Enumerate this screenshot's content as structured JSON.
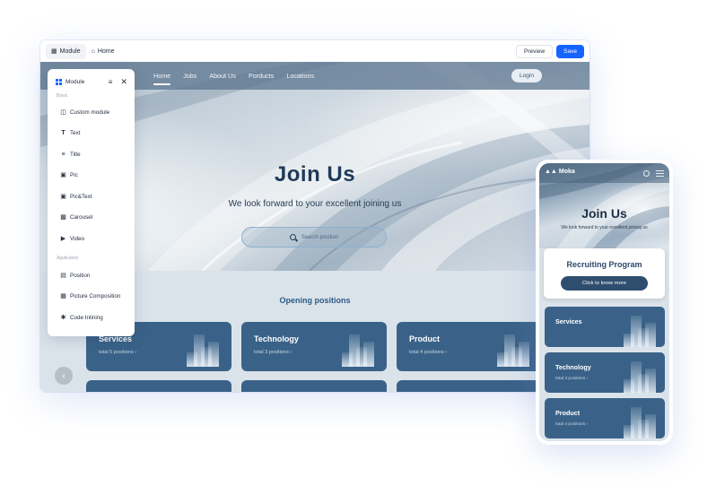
{
  "toolbar": {
    "module_label": "Module",
    "home_label": "Home",
    "preview_label": "Preview",
    "save_label": "Save",
    "accent_color": "#1664ff"
  },
  "site": {
    "nav": [
      {
        "label": "Home",
        "active": true
      },
      {
        "label": "Jobs",
        "active": false
      },
      {
        "label": "About Us",
        "active": false
      },
      {
        "label": "Porducts",
        "active": false
      },
      {
        "label": "Locations",
        "active": false
      }
    ],
    "login_label": "Login",
    "hero_title": "Join Us",
    "hero_subtitle": "We look forward to your excellent joining us",
    "search_placeholder": "Search position",
    "section_title": "Opening positions",
    "departments": [
      {
        "name": "Services",
        "count": "total 5 positions"
      },
      {
        "name": "Technology",
        "count": "total 3 positions"
      },
      {
        "name": "Product",
        "count": "total 4 positions"
      }
    ],
    "card_color": "#3a6288"
  },
  "module_panel": {
    "title": "Module",
    "sections": [
      {
        "label": "Basic",
        "items": [
          {
            "label": "Custom module",
            "icon": "custom-module-icon"
          },
          {
            "label": "Text",
            "icon": "text-icon"
          },
          {
            "label": "Title",
            "icon": "title-icon"
          },
          {
            "label": "Pic",
            "icon": "picture-icon"
          },
          {
            "label": "Pic&Text",
            "icon": "picture-text-icon"
          },
          {
            "label": "Carousel",
            "icon": "carousel-icon"
          },
          {
            "label": "Video",
            "icon": "video-icon"
          }
        ]
      },
      {
        "label": "Application",
        "items": [
          {
            "label": "Position",
            "icon": "position-icon"
          },
          {
            "label": "Picture Composition",
            "icon": "picture-composition-icon"
          },
          {
            "label": "Code Inlining",
            "icon": "code-inlining-icon"
          }
        ]
      }
    ]
  },
  "mobile": {
    "brand": "Moka",
    "hero_title": "Join Us",
    "hero_subtitle": "We look forward to your excellent joining us",
    "program_title": "Recruiting Program",
    "program_button": "Click to know more",
    "departments": [
      {
        "name": "Services",
        "count": ""
      },
      {
        "name": "Technology",
        "count": "total 3 positions"
      },
      {
        "name": "Product",
        "count": "total 4 positions"
      }
    ]
  }
}
